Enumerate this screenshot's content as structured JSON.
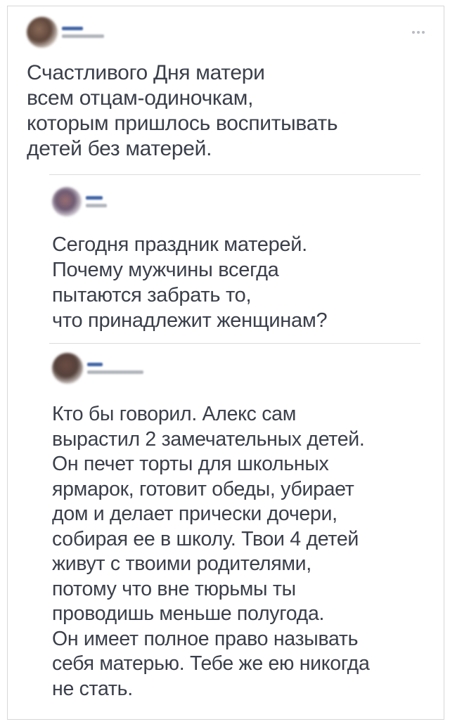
{
  "tweet1": {
    "text": "Счастливого Дня матери\nвсем отцам-одиночкам,\nкоторым пришлось воспитывать\nдетей без матерей."
  },
  "tweet2": {
    "text": "Сегодня праздник матерей.\nПочему мужчины всегда\nпытаются забрать то,\nчто принадлежит женщинам?"
  },
  "tweet3": {
    "text": "Кто бы говорил. Алекс сам\nвырастил 2 замечательных детей.\nОн печет торты для школьных\nярмарок, готовит обеды, убирает\nдом и делает прически дочери,\nсобирая ее в школу. Твои 4 детей\nживут с твоими родителями,\nпотому что вне тюрьмы ты\nпроводишь меньше полугода.\nОн имеет полное право называть\nсебя матерью. Тебе же ею никогда\nне стать."
  },
  "icons": {
    "more": "more-horizontal-icon"
  },
  "colors": {
    "text": "#3a3f4a",
    "blurred_name": "#3f63a6",
    "blurred_handle": "#b0b4bb",
    "divider": "#dcdcdc"
  }
}
